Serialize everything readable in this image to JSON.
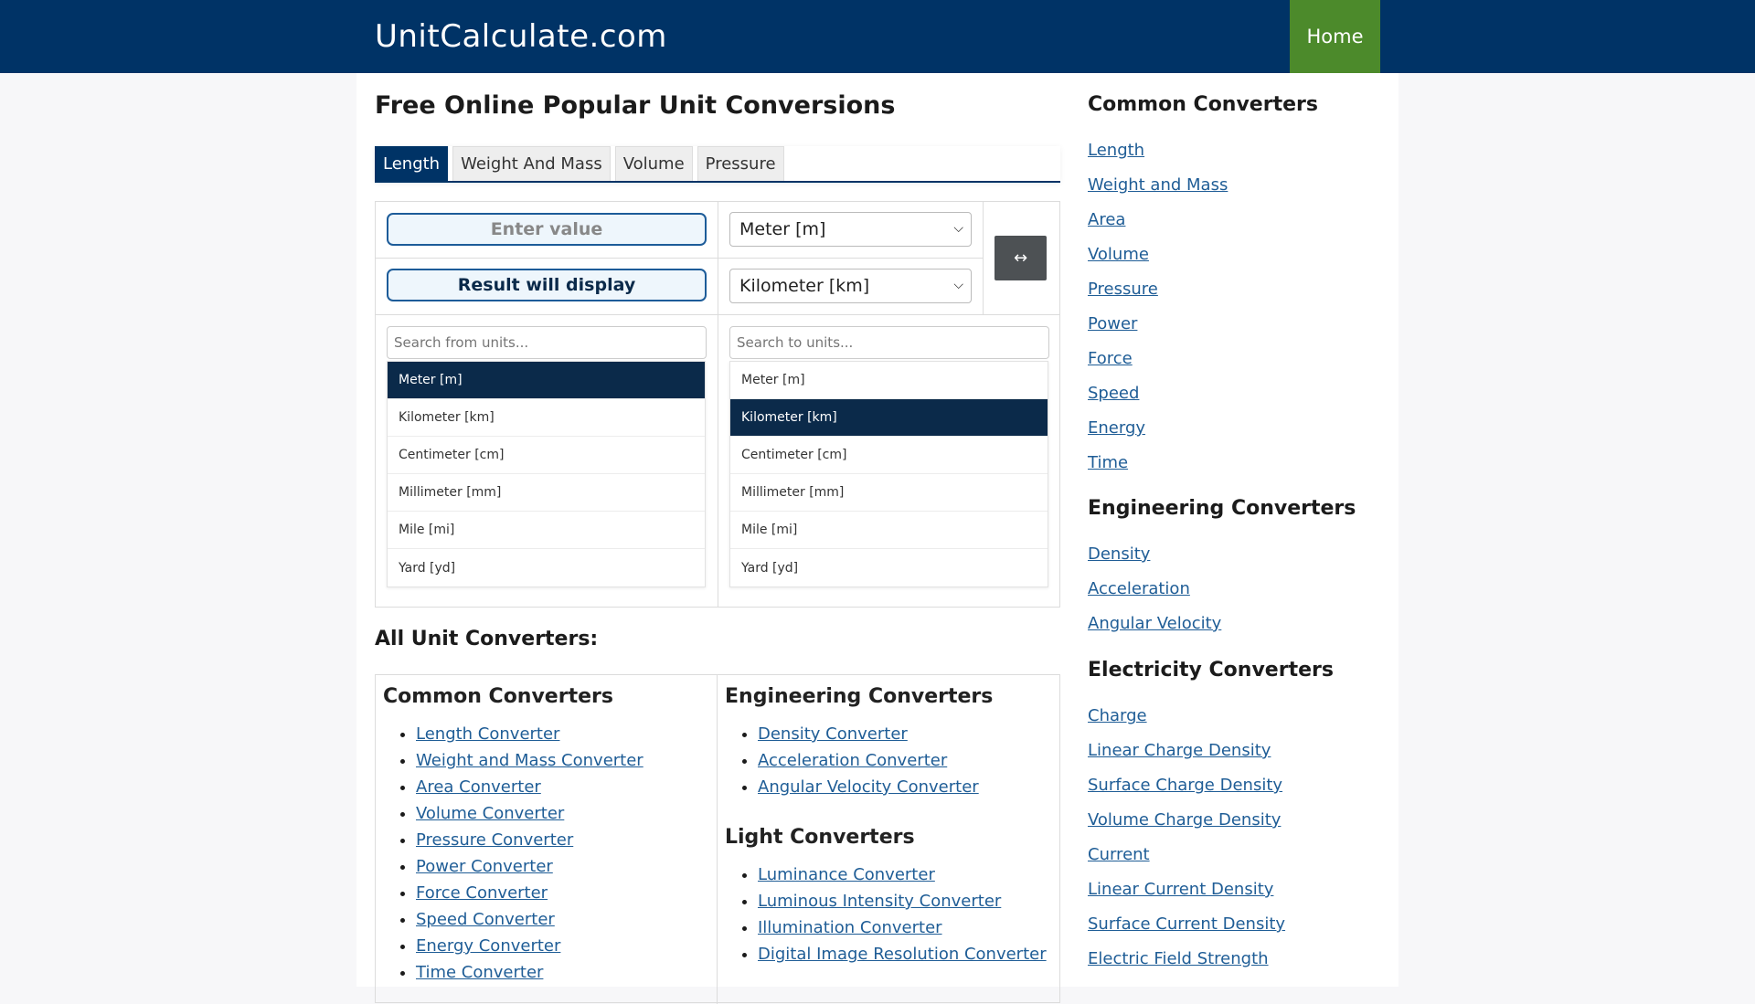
{
  "header": {
    "brand": "UnitCalculate.com",
    "home_label": "Home"
  },
  "main": {
    "title": "Free Online Popular Unit Conversions",
    "tabs": [
      {
        "label": "Length",
        "active": true
      },
      {
        "label": "Weight And Mass",
        "active": false
      },
      {
        "label": "Volume",
        "active": false
      },
      {
        "label": "Pressure",
        "active": false
      }
    ],
    "converter": {
      "value_placeholder": "Enter value",
      "result_placeholder": "Result will display",
      "from_unit": "Meter [m]",
      "to_unit": "Kilometer [km]",
      "swap_icon": "↔",
      "from_search_placeholder": "Search from units...",
      "to_search_placeholder": "Search to units...",
      "from_units": [
        "Meter [m]",
        "Kilometer [km]",
        "Centimeter [cm]",
        "Millimeter [mm]",
        "Mile [mi]",
        "Yard [yd]"
      ],
      "to_units": [
        "Meter [m]",
        "Kilometer [km]",
        "Centimeter [cm]",
        "Millimeter [mm]",
        "Mile [mi]",
        "Yard [yd]"
      ],
      "from_selected_index": 0,
      "to_selected_index": 1
    },
    "all_title": "All Unit Converters:",
    "all_converters": {
      "common": {
        "title": "Common Converters",
        "items": [
          "Length Converter",
          "Weight and Mass Converter",
          "Area Converter",
          "Volume Converter",
          "Pressure Converter",
          "Power Converter",
          "Force Converter",
          "Speed Converter",
          "Energy Converter",
          "Time Converter"
        ]
      },
      "engineering": {
        "title": "Engineering Converters",
        "items": [
          "Density Converter",
          "Acceleration Converter",
          "Angular Velocity Converter"
        ]
      },
      "light": {
        "title": "Light Converters",
        "items": [
          "Luminance Converter",
          "Luminous Intensity Converter",
          "Illumination Converter",
          "Digital Image Resolution Converter"
        ]
      }
    }
  },
  "sidebar": {
    "common": {
      "title": "Common Converters",
      "items": [
        "Length",
        "Weight and Mass",
        "Area",
        "Volume",
        "Pressure",
        "Power",
        "Force",
        "Speed",
        "Energy",
        "Time"
      ]
    },
    "engineering": {
      "title": "Engineering Converters",
      "items": [
        "Density",
        "Acceleration",
        "Angular Velocity"
      ]
    },
    "electricity": {
      "title": "Electricity Converters",
      "items": [
        "Charge",
        "Linear Charge Density",
        "Surface Charge Density",
        "Volume Charge Density",
        "Current",
        "Linear Current Density",
        "Surface Current Density",
        "Electric Field Strength"
      ]
    }
  },
  "colors": {
    "header_bg": "#003366",
    "home_bg": "#4c8a2b",
    "selected_unit_bg": "#0b2a4a",
    "link": "#1f5d96"
  }
}
